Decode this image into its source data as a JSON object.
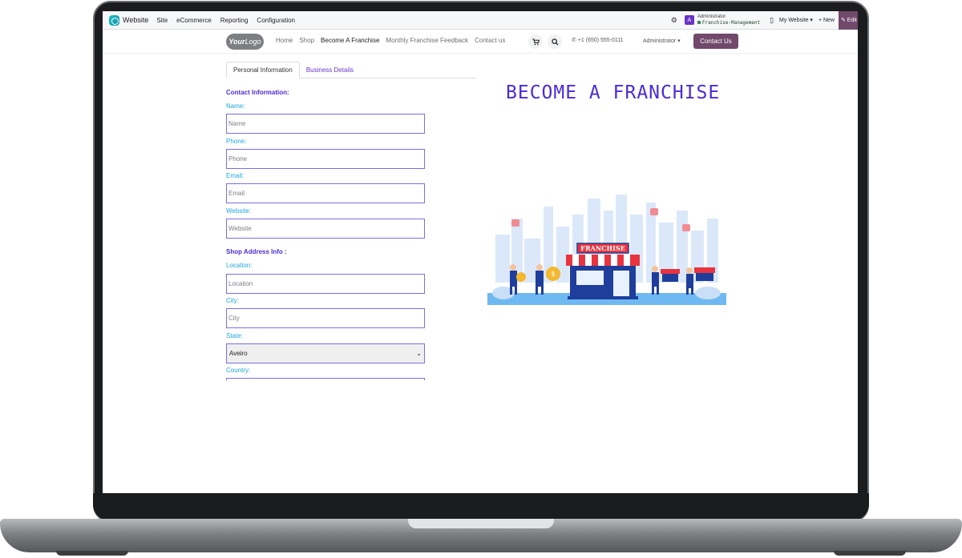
{
  "admin_bar": {
    "app_name": "Website",
    "menu": [
      "Site",
      "eCommerce",
      "Reporting",
      "Configuration"
    ],
    "avatar_letter": "A",
    "user_name": "Administrator",
    "database": "Franchise-Management",
    "my_website": "My Website ▾",
    "new_label": "+ New",
    "edit_label": "✎ Edit"
  },
  "header": {
    "logo_bold": "Your",
    "logo_rest": "Logo",
    "nav": [
      "Home",
      "Shop",
      "Become A Franchise",
      "Monthly Franchise Feedback",
      "Contact us"
    ],
    "active_nav": "Become A Franchise",
    "phone": "+1 (650) 555-0111",
    "admin_dropdown": "Administrator ▾",
    "contact_button": "Contact Us"
  },
  "tabs": {
    "personal": "Personal Information",
    "business": "Business Details"
  },
  "form": {
    "contact_section": "Contact Information:",
    "name_label": "Name:",
    "name_placeholder": "Name",
    "phone_label": "Phone:",
    "phone_placeholder": "Phone",
    "email_label": "Email:",
    "email_placeholder": "Email",
    "website_label": "Website:",
    "website_placeholder": "Website",
    "address_section": "Shop Address Info :",
    "location_label": "Location:",
    "location_placeholder": "Location",
    "city_label": "City:",
    "city_placeholder": "City",
    "state_label": "State:",
    "state_value": "Aveiro",
    "country_label": "Country:"
  },
  "hero": {
    "title": "BECOME A FRANCHISE",
    "sign_text": "FRANCHISE"
  },
  "colors": {
    "brand": "#71496b",
    "accent_purple": "#4b2bd6",
    "label_blue": "#1fa7e0",
    "input_border": "#7a6ee6"
  }
}
